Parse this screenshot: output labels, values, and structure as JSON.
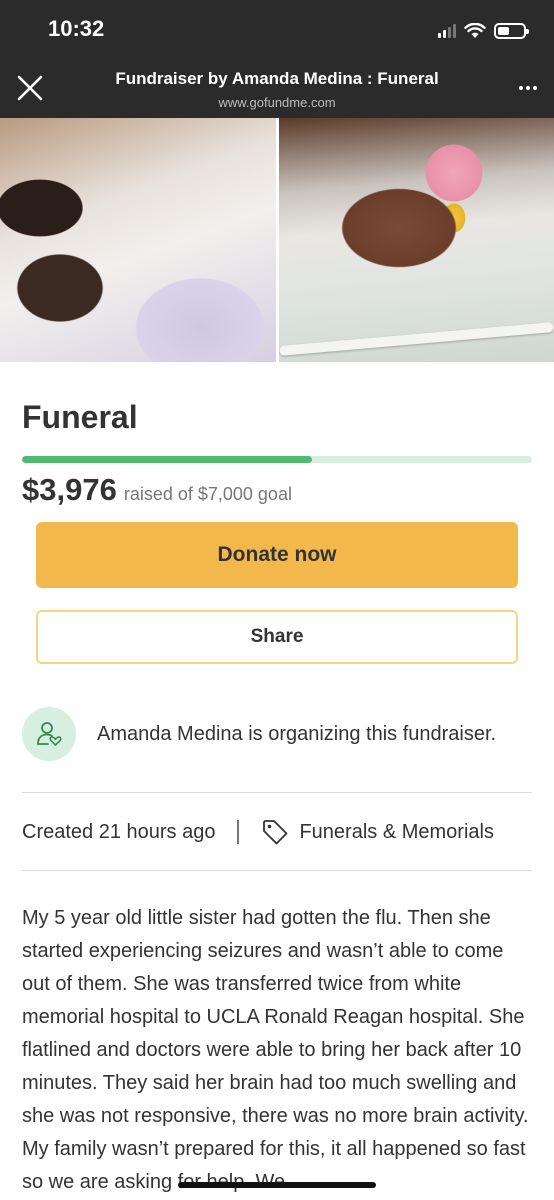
{
  "status_bar": {
    "time": "10:32",
    "icons": [
      "cellular-signal-icon",
      "wifi-icon",
      "battery-icon"
    ]
  },
  "browser": {
    "title": "Fundraiser by Amanda Medina : Funeral",
    "url": "www.gofundme.com",
    "close_icon": "close-icon",
    "more_icon": "more-options-icon"
  },
  "fundraiser": {
    "title": "Funeral",
    "raised_amount": "$3,976",
    "raised_text": "raised of $7,000 goal",
    "progress_fraction": 0.568,
    "donate_label": "Donate now",
    "share_label": "Share",
    "organizer_text": "Amanda Medina is organizing this fundraiser.",
    "created_text": "Created 21 hours ago",
    "category": "Funerals & Memorials",
    "story": "My 5 year old little sister had gotten the flu. Then she started experiencing seizures and wasn’t able to come out of them. She was transferred twice from white memorial hospital to UCLA Ronald Reagan hospital. She flatlined and doctors were able to bring her back after 10 minutes. They said her brain had too much swelling and she was not responsive, there was no more brain activity. My family wasn’t prepared for this, it all happened so fast so we are asking for help. We"
  },
  "colors": {
    "header_bg": "#2b2b2b",
    "progress_fill": "#53b96e",
    "progress_track": "#d7eee0",
    "donate_bg": "#f2b84b",
    "share_border": "#f2d680",
    "avatar_bg": "#d7efe0"
  }
}
